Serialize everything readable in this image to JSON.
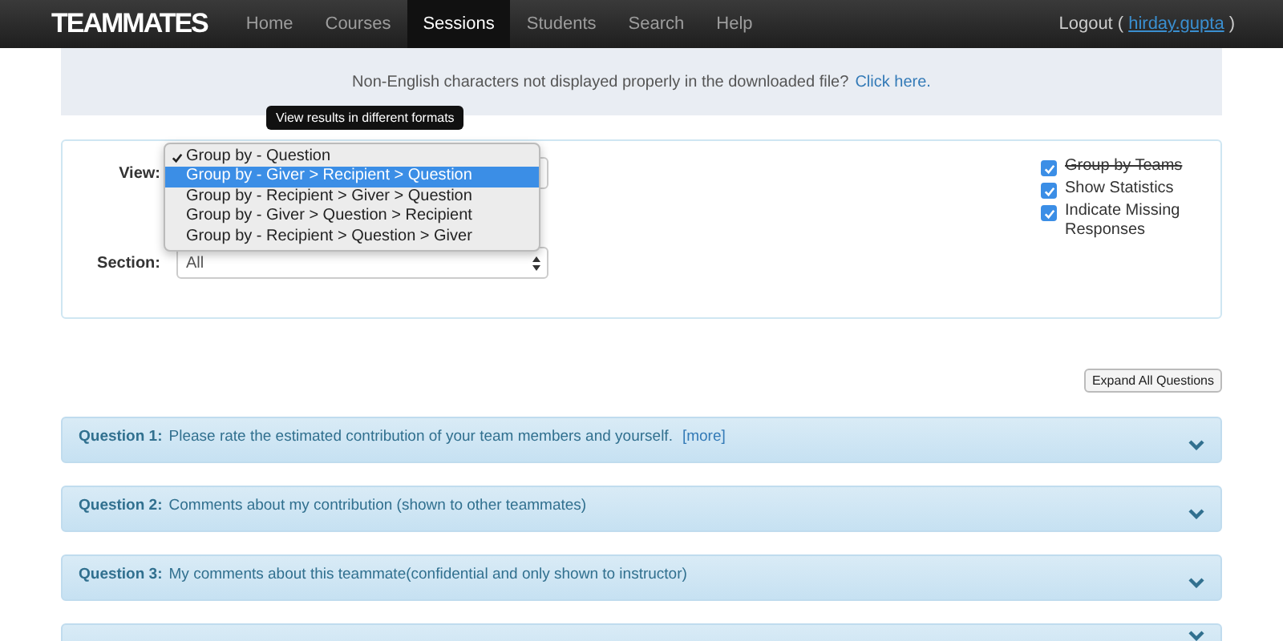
{
  "navbar": {
    "brand": "TEAMMATES",
    "items": [
      {
        "label": "Home",
        "selected": false
      },
      {
        "label": "Courses",
        "selected": false
      },
      {
        "label": "Sessions",
        "selected": true
      },
      {
        "label": "Students",
        "selected": false
      },
      {
        "label": "Search",
        "selected": false
      },
      {
        "label": "Help",
        "selected": false
      }
    ],
    "logout": "Logout (",
    "user": "hirday.gupta",
    "close": ")"
  },
  "notice": {
    "text": "Non-English characters not displayed properly in the downloaded file?",
    "link": "Click here."
  },
  "filters": {
    "tooltip": "View results in different formats",
    "view": {
      "label": "View:",
      "options": [
        {
          "label": "Group by - Question",
          "selected": true,
          "hovered": false
        },
        {
          "label": "Group by - Giver > Recipient > Question",
          "selected": false,
          "hovered": true
        },
        {
          "label": "Group by - Recipient > Giver > Question",
          "selected": false,
          "hovered": false
        },
        {
          "label": "Group by - Giver > Question > Recipient",
          "selected": false,
          "hovered": false
        },
        {
          "label": "Group by - Recipient > Question > Giver",
          "selected": false,
          "hovered": false
        }
      ]
    },
    "section": {
      "label": "Section:",
      "value": "All"
    },
    "checkboxes": [
      {
        "label": "Group by Teams",
        "checked": true,
        "disabled": true
      },
      {
        "label": "Show Statistics",
        "checked": true,
        "disabled": false
      },
      {
        "label": "Indicate Missing Responses",
        "checked": true,
        "disabled": false
      }
    ]
  },
  "expand_button": "Expand All Questions",
  "questions": [
    {
      "number": "Question 1:",
      "text": "Please rate the estimated contribution of your team members and yourself.",
      "more": "[more]"
    },
    {
      "number": "Question 2:",
      "text": "Comments about my contribution (shown to other teammates)"
    },
    {
      "number": "Question 3:",
      "text": "My comments about this teammate(confidential and only shown to instructor)"
    },
    {
      "kind": "cut-off"
    }
  ]
}
